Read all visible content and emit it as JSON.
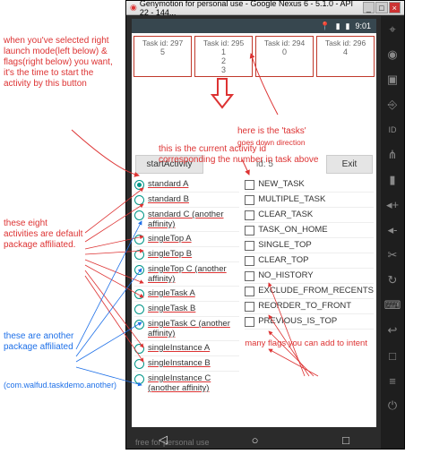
{
  "window": {
    "title": "Genymotion for personal use - Google Nexus 6 - 5.1.0 - API 22 - 144..."
  },
  "status": {
    "time": "9:01",
    "battery_icon": "battery-icon",
    "signal_icon": "signal-icon",
    "loc_icon": "location-icon"
  },
  "tasks": [
    {
      "label": "Task id: 297",
      "ids": [
        "5"
      ]
    },
    {
      "label": "Task id: 295",
      "ids": [
        "1",
        "2",
        "3"
      ]
    },
    {
      "label": "Task id: 294",
      "ids": [
        "0"
      ]
    },
    {
      "label": "Task id: 296",
      "ids": [
        "4"
      ]
    }
  ],
  "buttons": {
    "start": "startActivity",
    "exit": "Exit",
    "current_id": "id: 5"
  },
  "launch_modes": [
    {
      "label": "standard A",
      "selected": true
    },
    {
      "label": "standard B"
    },
    {
      "label": "standard C (another affinity)"
    },
    {
      "label": "singleTop A"
    },
    {
      "label": "singleTop B"
    },
    {
      "label": "singleTop C (another affinity)"
    },
    {
      "label": "singleTask A"
    },
    {
      "label": "singleTask B"
    },
    {
      "label": "singleTask C (another affinity)"
    },
    {
      "label": "singleInstance A"
    },
    {
      "label": "singleInstance B"
    },
    {
      "label": "singleInstance C (another affinity)"
    }
  ],
  "flags": [
    "NEW_TASK",
    "MULTIPLE_TASK",
    "CLEAR_TASK",
    "TASK_ON_HOME",
    "SINGLE_TOP",
    "CLEAR_TOP",
    "NO_HISTORY",
    "EXCLUDE_FROM_RECENTS",
    "REORDER_TO_FRONT",
    "PREVIOUS_IS_TOP"
  ],
  "rail_icons": [
    "gps",
    "camera",
    "capture",
    "remote",
    "id",
    "rss",
    "battery",
    "vol-up",
    "vol-down",
    "scissors",
    "rotate",
    "keys",
    "back",
    "home",
    "recent",
    "power"
  ],
  "footer": {
    "left": "◁",
    "mid": "○",
    "right": "□"
  },
  "watermark": "free for personal use",
  "annotations": {
    "a1": "when you've selected right launch mode(left below) & flags(right below) you want, it's the time to start the activity by this button",
    "a2": "these eight activities are default package affiliated.",
    "a3": "these are another package affiliated",
    "a4": "(com.walfud.taskdemo.another)",
    "a5": "here is the 'tasks'",
    "a5b": "goes down direction",
    "a6": "this is the current activity id",
    "a7": "corresponding the number in task above",
    "a8": "many flags you can add to intent"
  }
}
